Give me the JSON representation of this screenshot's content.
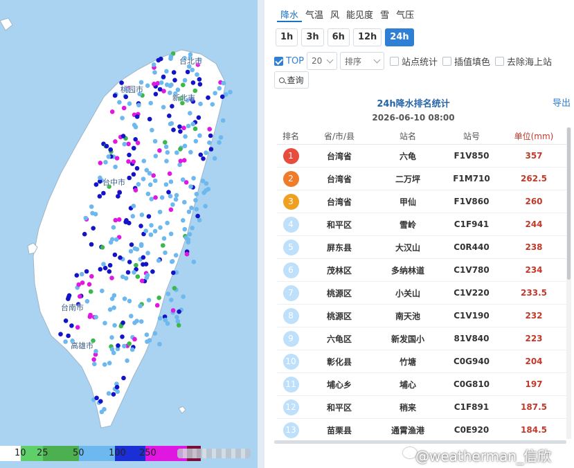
{
  "map": {
    "cities": [
      "台北市",
      "桃园市",
      "新北市",
      "台中市",
      "台南市",
      "高雄市"
    ],
    "legend": [
      {
        "label": "",
        "color": "#ffffff"
      },
      {
        "label": "10",
        "color": "#5fcf6a"
      },
      {
        "label": "25",
        "color": "#4caf50"
      },
      {
        "label": "50",
        "color": "#6db8ee"
      },
      {
        "label": "100",
        "color": "#1b2fd6"
      },
      {
        "label": "250",
        "color": "#e017e0"
      },
      {
        "label": "",
        "color": "#7b0d3b"
      }
    ],
    "dot_colors": {
      "light_blue": "#6db8ee",
      "blue": "#1313c8",
      "green": "#3cb84a",
      "magenta": "#e017e0",
      "maroon": "#7b0d3b"
    }
  },
  "panel": {
    "tabs": [
      {
        "label": "降水",
        "active": true
      },
      {
        "label": "气温",
        "active": false
      },
      {
        "label": "风",
        "active": false
      },
      {
        "label": "能见度",
        "active": false
      },
      {
        "label": "雪",
        "active": false
      },
      {
        "label": "气压",
        "active": false
      }
    ],
    "periods": [
      {
        "label": "1h",
        "active": false
      },
      {
        "label": "3h",
        "active": false
      },
      {
        "label": "6h",
        "active": false
      },
      {
        "label": "12h",
        "active": false
      },
      {
        "label": "24h",
        "active": true
      }
    ],
    "options": {
      "top_label": "TOP",
      "top_checked": true,
      "top_value": "20",
      "sort_placeholder": "排序",
      "station_stat": "站点统计",
      "interp_fill": "插值填色",
      "remove_sea": "去除海上站"
    },
    "query_label": "查询",
    "title": "24h降水排名统计",
    "export_label": "导出",
    "date": "2026-06-10 08:00",
    "columns": [
      "排名",
      "省/市/县",
      "站名",
      "站号",
      "单位(mm)"
    ],
    "rows": [
      {
        "rank": "1",
        "prov": "台湾省",
        "name": "六龟",
        "id": "F1V850",
        "value": "357",
        "color": "#e74c3c"
      },
      {
        "rank": "2",
        "prov": "台湾省",
        "name": "二万坪",
        "id": "F1M710",
        "value": "262.5",
        "color": "#f07c2a"
      },
      {
        "rank": "3",
        "prov": "台湾省",
        "name": "甲仙",
        "id": "F1V860",
        "value": "260",
        "color": "#f0a020"
      },
      {
        "rank": "4",
        "prov": "和平区",
        "name": "雪岭",
        "id": "C1F941",
        "value": "244",
        "color": "#bfe0fa"
      },
      {
        "rank": "5",
        "prov": "屏东县",
        "name": "大汉山",
        "id": "C0R440",
        "value": "238",
        "color": "#bfe0fa"
      },
      {
        "rank": "6",
        "prov": "茂林区",
        "name": "多纳林道",
        "id": "C1V780",
        "value": "234",
        "color": "#bfe0fa"
      },
      {
        "rank": "7",
        "prov": "桃源区",
        "name": "小关山",
        "id": "C1V220",
        "value": "233.5",
        "color": "#bfe0fa"
      },
      {
        "rank": "8",
        "prov": "桃源区",
        "name": "南天池",
        "id": "C1V190",
        "value": "232",
        "color": "#bfe0fa"
      },
      {
        "rank": "9",
        "prov": "六龟区",
        "name": "新发国小",
        "id": "81V840",
        "value": "223",
        "color": "#bfe0fa"
      },
      {
        "rank": "10",
        "prov": "彰化县",
        "name": "竹塘",
        "id": "C0G940",
        "value": "204",
        "color": "#bfe0fa"
      },
      {
        "rank": "11",
        "prov": "埔心乡",
        "name": "埔心",
        "id": "C0G810",
        "value": "197",
        "color": "#bfe0fa"
      },
      {
        "rank": "12",
        "prov": "和平区",
        "name": "稍来",
        "id": "C1F891",
        "value": "187.5",
        "color": "#bfe0fa"
      },
      {
        "rank": "13",
        "prov": "苗栗县",
        "name": "通霄渔港",
        "id": "C0E920",
        "value": "184.5",
        "color": "#bfe0fa"
      }
    ]
  },
  "watermark": "@weatherman_信欣"
}
